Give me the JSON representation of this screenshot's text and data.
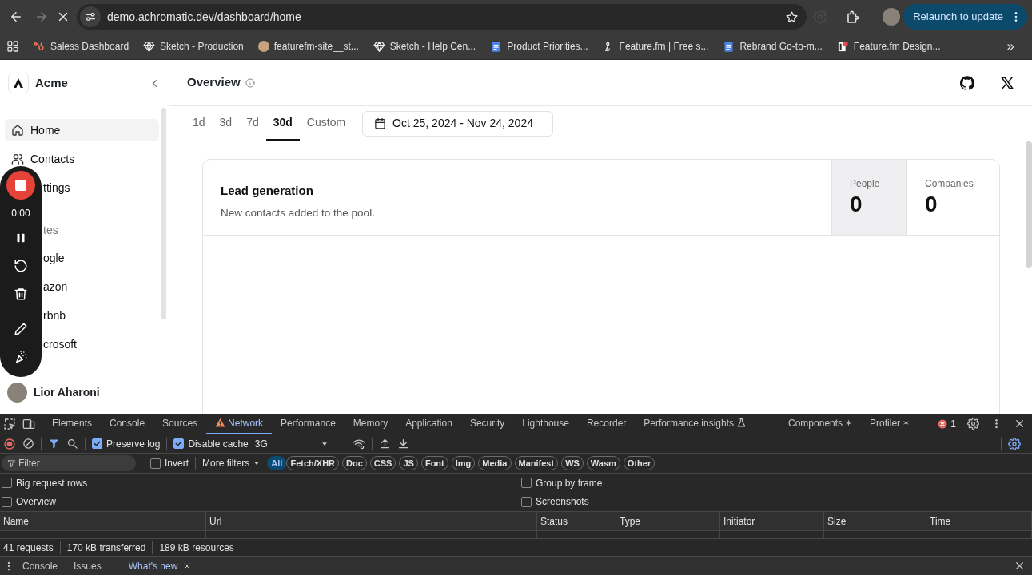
{
  "browser": {
    "nav": {
      "back_disabled": false,
      "forward_disabled": true
    },
    "url": "demo.achromatic.dev/dashboard/home",
    "relaunch_button": "Relaunch to update",
    "bookmarks": [
      {
        "label": "Saless Dashboard"
      },
      {
        "label": "Sketch - Production"
      },
      {
        "label": "featurefm-site__st..."
      },
      {
        "label": "Sketch - Help Cen..."
      },
      {
        "label": "Product Priorities..."
      },
      {
        "label": "Feature.fm | Free s..."
      },
      {
        "label": "Rebrand Go-to-m..."
      },
      {
        "label": "Feature.fm Design..."
      }
    ],
    "more_bookmarks": "»"
  },
  "sidebar": {
    "brand": "Acme",
    "items": [
      {
        "label": "Home",
        "selected": true
      },
      {
        "label": "Contacts",
        "selected": false
      },
      {
        "label": "ttings",
        "selected": false
      }
    ],
    "section_label": "tes",
    "favorites": [
      {
        "label": "ogle"
      },
      {
        "label": "azon"
      },
      {
        "label": "rbnb"
      },
      {
        "label": "crosoft"
      }
    ],
    "user": "Lior Aharoni"
  },
  "recorder": {
    "time": "0:00"
  },
  "header": {
    "title": "Overview"
  },
  "range_tabs": [
    {
      "label": "1d",
      "selected": false
    },
    {
      "label": "3d",
      "selected": false
    },
    {
      "label": "7d",
      "selected": false
    },
    {
      "label": "30d",
      "selected": true
    },
    {
      "label": "Custom",
      "selected": false
    }
  ],
  "date_range": "Oct 25, 2024 - Nov 24, 2024",
  "card": {
    "title": "Lead generation",
    "description": "New contacts added to the pool.",
    "stats": [
      {
        "label": "People",
        "value": "0",
        "selected": true
      },
      {
        "label": "Companies",
        "value": "0",
        "selected": false
      }
    ]
  },
  "devtools": {
    "tabs": [
      {
        "label": "Elements",
        "selected": false,
        "kind": "plain"
      },
      {
        "label": "Console",
        "selected": false,
        "kind": "plain"
      },
      {
        "label": "Sources",
        "selected": false,
        "kind": "plain"
      },
      {
        "label": "Network",
        "selected": true,
        "kind": "warning"
      },
      {
        "label": "Performance",
        "selected": false,
        "kind": "plain"
      },
      {
        "label": "Memory",
        "selected": false,
        "kind": "plain"
      },
      {
        "label": "Application",
        "selected": false,
        "kind": "plain"
      },
      {
        "label": "Security",
        "selected": false,
        "kind": "plain"
      },
      {
        "label": "Lighthouse",
        "selected": false,
        "kind": "plain"
      },
      {
        "label": "Recorder",
        "selected": false,
        "kind": "plain"
      },
      {
        "label": "Performance insights",
        "selected": false,
        "kind": "experiment"
      },
      {
        "label": "Components",
        "selected": false,
        "kind": "extension"
      },
      {
        "label": "Profiler",
        "selected": false,
        "kind": "extension"
      }
    ],
    "error_count": "1",
    "preserve_log": {
      "label": "Preserve log",
      "checked": true
    },
    "disable_cache": {
      "label": "Disable cache",
      "checked": true
    },
    "throttle": "3G",
    "filter_placeholder": "Filter",
    "invert": {
      "label": "Invert",
      "checked": false
    },
    "more_filters": "More filters",
    "type_filters": [
      {
        "label": "All",
        "selected": true
      },
      {
        "label": "Fetch/XHR",
        "selected": false
      },
      {
        "label": "Doc",
        "selected": false
      },
      {
        "label": "CSS",
        "selected": false
      },
      {
        "label": "JS",
        "selected": false
      },
      {
        "label": "Font",
        "selected": false
      },
      {
        "label": "Img",
        "selected": false
      },
      {
        "label": "Media",
        "selected": false
      },
      {
        "label": "Manifest",
        "selected": false
      },
      {
        "label": "WS",
        "selected": false
      },
      {
        "label": "Wasm",
        "selected": false
      },
      {
        "label": "Other",
        "selected": false
      }
    ],
    "options_left": [
      {
        "label": "Big request rows",
        "checked": false
      },
      {
        "label": "Overview",
        "checked": false
      }
    ],
    "options_right": [
      {
        "label": "Group by frame",
        "checked": false
      },
      {
        "label": "Screenshots",
        "checked": false
      }
    ],
    "columns": [
      "Name",
      "Url",
      "Status",
      "Type",
      "Initiator",
      "Size",
      "Time"
    ],
    "summary": [
      "41 requests",
      "170 kB transferred",
      "189 kB resources"
    ],
    "drawer_tabs": [
      {
        "label": "Console",
        "selected": false,
        "closable": false
      },
      {
        "label": "Issues",
        "selected": false,
        "closable": false
      },
      {
        "label": "What's new",
        "selected": true,
        "closable": true
      }
    ]
  }
}
